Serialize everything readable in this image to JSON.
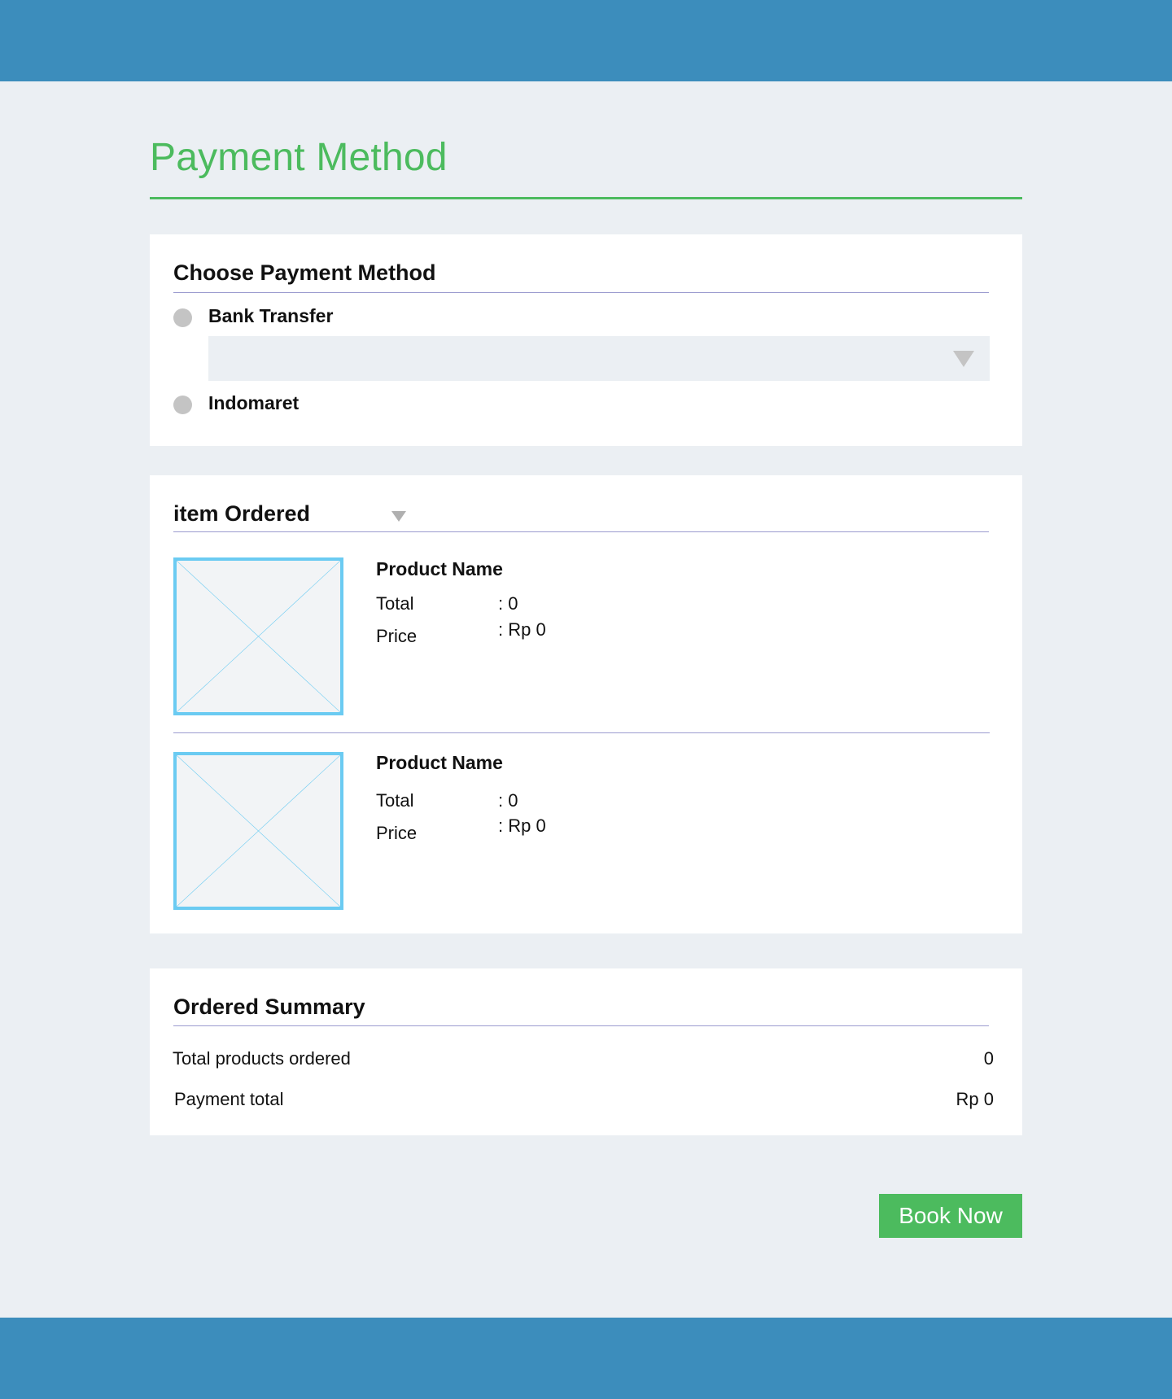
{
  "page": {
    "title": "Payment Method"
  },
  "payment": {
    "heading": "Choose Payment Method",
    "options": [
      {
        "label": "Bank Transfer"
      },
      {
        "label": "Indomaret"
      }
    ],
    "bank_select_value": ""
  },
  "items": {
    "heading": "item Ordered",
    "list": [
      {
        "name": "Product Name",
        "total_label": "Total",
        "total_value": ": 0",
        "price_label": "Price",
        "price_value": ": Rp 0"
      },
      {
        "name": "Product Name",
        "total_label": "Total",
        "total_value": ": 0",
        "price_label": "Price",
        "price_value": ": Rp 0"
      }
    ]
  },
  "summary": {
    "heading": "Ordered Summary",
    "total_products_label": "Total products ordered",
    "total_products_value": "0",
    "payment_total_label": "Payment total",
    "payment_total_value": "Rp 0"
  },
  "actions": {
    "book_label": "Book Now"
  },
  "colors": {
    "header_bar": "#3c8dbc",
    "accent_green": "#4cbb5e",
    "background": "#ebeff3",
    "image_placeholder_border": "#6bcbf2",
    "divider": "#9b9bcf"
  }
}
